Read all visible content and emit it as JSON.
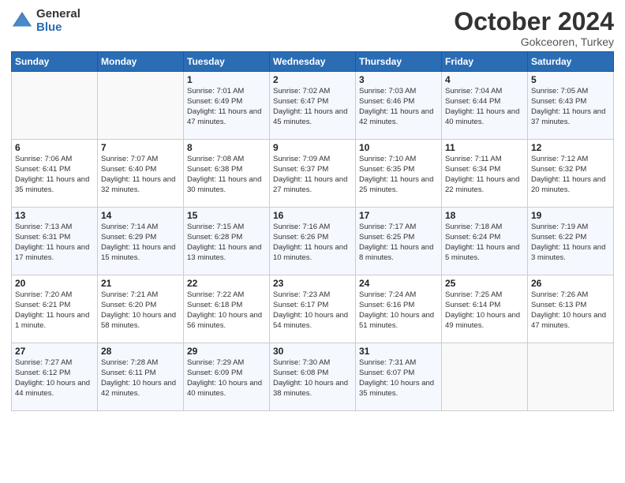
{
  "logo": {
    "general": "General",
    "blue": "Blue"
  },
  "header": {
    "month": "October 2024",
    "location": "Gokceoren, Turkey"
  },
  "weekdays": [
    "Sunday",
    "Monday",
    "Tuesday",
    "Wednesday",
    "Thursday",
    "Friday",
    "Saturday"
  ],
  "weeks": [
    [
      {
        "day": "",
        "content": ""
      },
      {
        "day": "",
        "content": ""
      },
      {
        "day": "1",
        "content": "Sunrise: 7:01 AM\nSunset: 6:49 PM\nDaylight: 11 hours and 47 minutes."
      },
      {
        "day": "2",
        "content": "Sunrise: 7:02 AM\nSunset: 6:47 PM\nDaylight: 11 hours and 45 minutes."
      },
      {
        "day": "3",
        "content": "Sunrise: 7:03 AM\nSunset: 6:46 PM\nDaylight: 11 hours and 42 minutes."
      },
      {
        "day": "4",
        "content": "Sunrise: 7:04 AM\nSunset: 6:44 PM\nDaylight: 11 hours and 40 minutes."
      },
      {
        "day": "5",
        "content": "Sunrise: 7:05 AM\nSunset: 6:43 PM\nDaylight: 11 hours and 37 minutes."
      }
    ],
    [
      {
        "day": "6",
        "content": "Sunrise: 7:06 AM\nSunset: 6:41 PM\nDaylight: 11 hours and 35 minutes."
      },
      {
        "day": "7",
        "content": "Sunrise: 7:07 AM\nSunset: 6:40 PM\nDaylight: 11 hours and 32 minutes."
      },
      {
        "day": "8",
        "content": "Sunrise: 7:08 AM\nSunset: 6:38 PM\nDaylight: 11 hours and 30 minutes."
      },
      {
        "day": "9",
        "content": "Sunrise: 7:09 AM\nSunset: 6:37 PM\nDaylight: 11 hours and 27 minutes."
      },
      {
        "day": "10",
        "content": "Sunrise: 7:10 AM\nSunset: 6:35 PM\nDaylight: 11 hours and 25 minutes."
      },
      {
        "day": "11",
        "content": "Sunrise: 7:11 AM\nSunset: 6:34 PM\nDaylight: 11 hours and 22 minutes."
      },
      {
        "day": "12",
        "content": "Sunrise: 7:12 AM\nSunset: 6:32 PM\nDaylight: 11 hours and 20 minutes."
      }
    ],
    [
      {
        "day": "13",
        "content": "Sunrise: 7:13 AM\nSunset: 6:31 PM\nDaylight: 11 hours and 17 minutes."
      },
      {
        "day": "14",
        "content": "Sunrise: 7:14 AM\nSunset: 6:29 PM\nDaylight: 11 hours and 15 minutes."
      },
      {
        "day": "15",
        "content": "Sunrise: 7:15 AM\nSunset: 6:28 PM\nDaylight: 11 hours and 13 minutes."
      },
      {
        "day": "16",
        "content": "Sunrise: 7:16 AM\nSunset: 6:26 PM\nDaylight: 11 hours and 10 minutes."
      },
      {
        "day": "17",
        "content": "Sunrise: 7:17 AM\nSunset: 6:25 PM\nDaylight: 11 hours and 8 minutes."
      },
      {
        "day": "18",
        "content": "Sunrise: 7:18 AM\nSunset: 6:24 PM\nDaylight: 11 hours and 5 minutes."
      },
      {
        "day": "19",
        "content": "Sunrise: 7:19 AM\nSunset: 6:22 PM\nDaylight: 11 hours and 3 minutes."
      }
    ],
    [
      {
        "day": "20",
        "content": "Sunrise: 7:20 AM\nSunset: 6:21 PM\nDaylight: 11 hours and 1 minute."
      },
      {
        "day": "21",
        "content": "Sunrise: 7:21 AM\nSunset: 6:20 PM\nDaylight: 10 hours and 58 minutes."
      },
      {
        "day": "22",
        "content": "Sunrise: 7:22 AM\nSunset: 6:18 PM\nDaylight: 10 hours and 56 minutes."
      },
      {
        "day": "23",
        "content": "Sunrise: 7:23 AM\nSunset: 6:17 PM\nDaylight: 10 hours and 54 minutes."
      },
      {
        "day": "24",
        "content": "Sunrise: 7:24 AM\nSunset: 6:16 PM\nDaylight: 10 hours and 51 minutes."
      },
      {
        "day": "25",
        "content": "Sunrise: 7:25 AM\nSunset: 6:14 PM\nDaylight: 10 hours and 49 minutes."
      },
      {
        "day": "26",
        "content": "Sunrise: 7:26 AM\nSunset: 6:13 PM\nDaylight: 10 hours and 47 minutes."
      }
    ],
    [
      {
        "day": "27",
        "content": "Sunrise: 7:27 AM\nSunset: 6:12 PM\nDaylight: 10 hours and 44 minutes."
      },
      {
        "day": "28",
        "content": "Sunrise: 7:28 AM\nSunset: 6:11 PM\nDaylight: 10 hours and 42 minutes."
      },
      {
        "day": "29",
        "content": "Sunrise: 7:29 AM\nSunset: 6:09 PM\nDaylight: 10 hours and 40 minutes."
      },
      {
        "day": "30",
        "content": "Sunrise: 7:30 AM\nSunset: 6:08 PM\nDaylight: 10 hours and 38 minutes."
      },
      {
        "day": "31",
        "content": "Sunrise: 7:31 AM\nSunset: 6:07 PM\nDaylight: 10 hours and 35 minutes."
      },
      {
        "day": "",
        "content": ""
      },
      {
        "day": "",
        "content": ""
      }
    ]
  ]
}
